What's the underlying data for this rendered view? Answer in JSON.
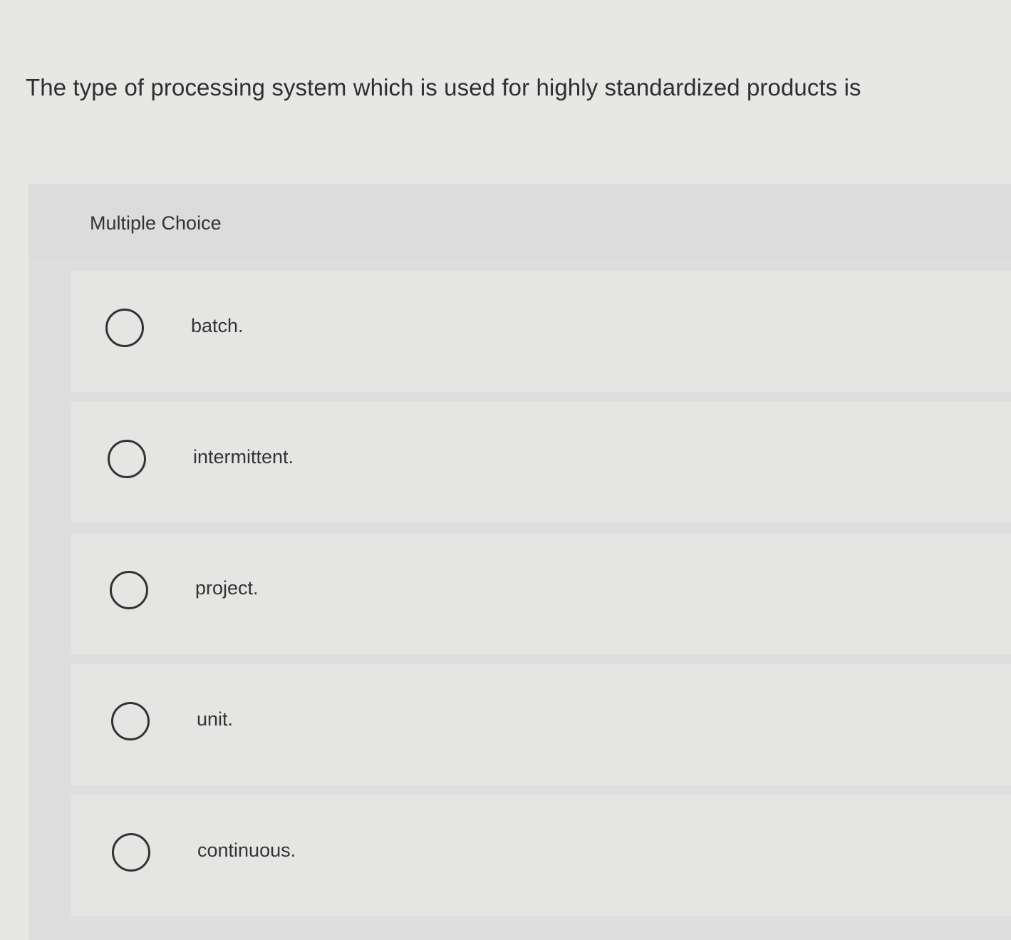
{
  "question": {
    "text": "The type of processing system which is used for highly standardized products is"
  },
  "multiple_choice": {
    "label": "Multiple Choice",
    "options": [
      {
        "label": "batch."
      },
      {
        "label": "intermittent."
      },
      {
        "label": "project."
      },
      {
        "label": "unit."
      },
      {
        "label": "continuous."
      }
    ]
  }
}
